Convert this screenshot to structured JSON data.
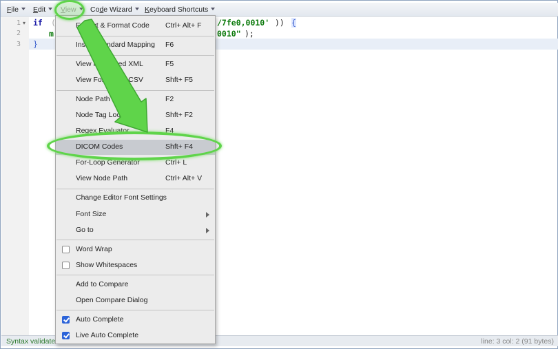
{
  "menubar": {
    "file": {
      "mnemonic": "F",
      "rest": "ile"
    },
    "edit": {
      "mnemonic": "E",
      "rest": "dit"
    },
    "view": {
      "mnemonic": "V",
      "rest": "iew"
    },
    "code_wizard": {
      "pre": "Co",
      "mnemonic": "d",
      "rest": "e Wizard"
    },
    "keyboard_shortcuts": {
      "mnemonic": "K",
      "rest": "eyboard Shortcuts"
    }
  },
  "editor": {
    "line_numbers": [
      "1",
      "2",
      "3"
    ],
    "fold_marker": "▾",
    "line1": {
      "keyword": "if",
      "open_paren": "(",
      "frag_string": "/7fe0,0010'",
      "frag_close": "))",
      "brace": "{"
    },
    "line2": {
      "indent_frag": "m",
      "frag_string": "0010\"",
      "frag_tail": ");"
    },
    "line3": {
      "brace": "}"
    }
  },
  "menu": {
    "items": [
      {
        "label": "Extract & Format Code",
        "mnemonic_index": 10,
        "shortcut": "Ctrl+ Alt+ F"
      },
      {
        "label": "Insert Standard Mapping",
        "shortcut": "F6"
      },
      {
        "label": "View Formatted XML",
        "shortcut": "F5"
      },
      {
        "label": "View Formatted CSV",
        "shortcut": "Shft+ F5"
      },
      {
        "label": "Node Path Lookup",
        "shortcut": "F2"
      },
      {
        "label": "Node Tag Lookup",
        "shortcut": "Shft+ F2"
      },
      {
        "label": "Regex Evaluator",
        "shortcut": "F4"
      },
      {
        "label": "DICOM Codes",
        "shortcut": "Shft+ F4"
      },
      {
        "label": "For-Loop Generator",
        "shortcut": "Ctrl+ L"
      },
      {
        "label": "View Node Path",
        "shortcut": "Ctrl+ Alt+ V"
      },
      {
        "label": "Change Editor Font Settings"
      },
      {
        "label": "Font Size"
      },
      {
        "label": "Go to"
      },
      {
        "label": "Word Wrap",
        "checked": false
      },
      {
        "label": "Show Whitespaces",
        "checked": false
      },
      {
        "label": "Add to Compare"
      },
      {
        "label": "Open Compare Dialog"
      },
      {
        "label": "Auto Complete",
        "checked": true
      },
      {
        "label": "Live Auto Complete",
        "checked": true
      }
    ]
  },
  "status": {
    "left": "Syntax validated",
    "right": "line: 3  col: 2  (91 bytes)"
  },
  "colors": {
    "annotation_green": "#5fd44a",
    "checkbox_blue": "#2b63d9",
    "status_green": "#2d7a2d"
  }
}
